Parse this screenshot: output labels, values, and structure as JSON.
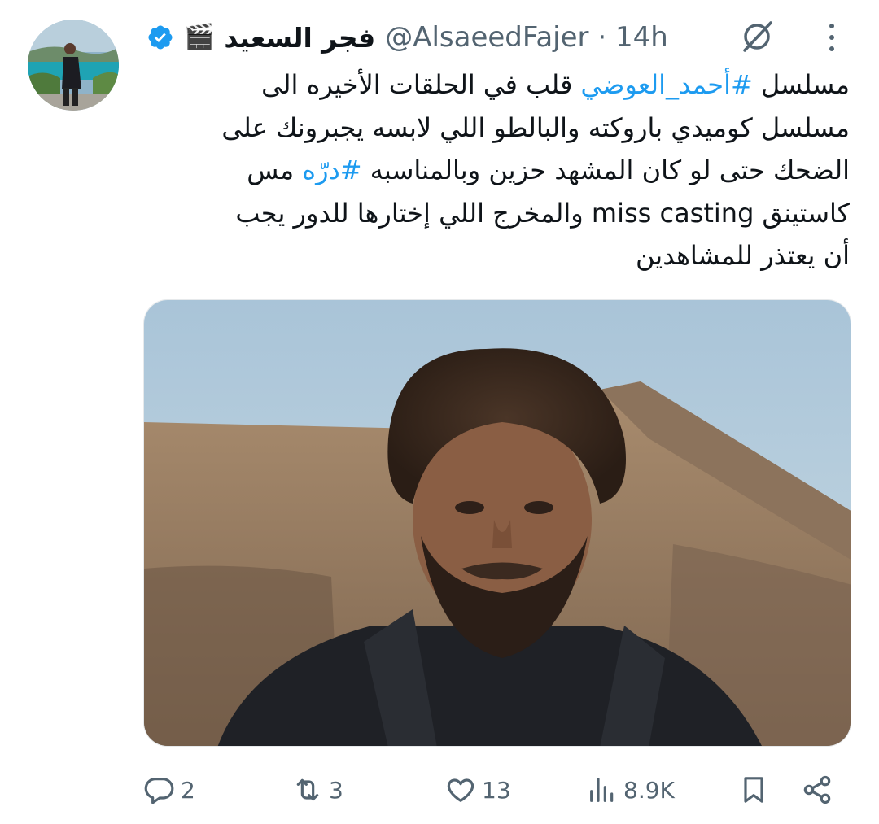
{
  "tweet": {
    "author": {
      "display_name": "فجر السعيد",
      "name_emoji": "🎬",
      "handle": "@AlsaeedFajer",
      "separator": "·",
      "time": "14h",
      "verified": true
    },
    "icons": {
      "grok": "grok-icon",
      "more": "more-vertical-icon"
    },
    "text_lines": [
      {
        "segments": [
          {
            "text": "مسلسل ",
            "type": "text"
          },
          {
            "text": "#أحمد_العوضي",
            "type": "hashtag"
          },
          {
            "text": " قلب في الحلقات الأخيره الى",
            "type": "text"
          }
        ]
      },
      {
        "segments": [
          {
            "text": "مسلسل كوميدي باروكته والبالطو اللي لابسه يجبرونك على",
            "type": "text"
          }
        ]
      },
      {
        "segments": [
          {
            "text": "الضحك حتى لو كان المشهد حزين وبالمناسبه ",
            "type": "text"
          },
          {
            "text": "#درّه",
            "type": "hashtag"
          },
          {
            "text": " مس",
            "type": "text"
          }
        ]
      },
      {
        "segments": [
          {
            "text": "كاستينق miss casting والمخرج اللي إختارها للدور يجب",
            "type": "text"
          }
        ]
      },
      {
        "segments": [
          {
            "text": "أن يعتذر للمشاهدين",
            "type": "text"
          }
        ]
      }
    ],
    "media": {
      "kind": "photo"
    },
    "actions": {
      "replies": {
        "icon": "reply-icon",
        "count": "2"
      },
      "retweets": {
        "icon": "retweet-icon",
        "count": "3"
      },
      "likes": {
        "icon": "heart-icon",
        "count": "13"
      },
      "views": {
        "icon": "views-icon",
        "count": "8.9K"
      },
      "bookmark": {
        "icon": "bookmark-icon"
      },
      "share": {
        "icon": "share-icon"
      }
    },
    "colors": {
      "text": "#0f1419",
      "secondary": "#536471",
      "accent": "#1d9bf0"
    }
  }
}
